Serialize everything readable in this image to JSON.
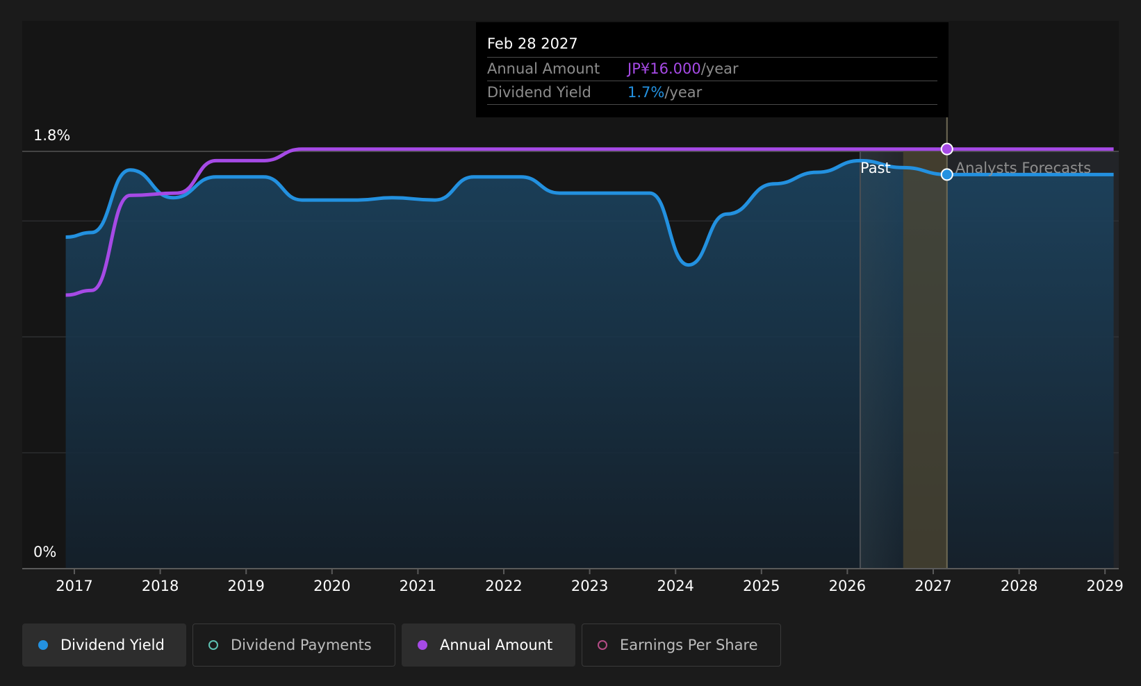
{
  "chart_data": {
    "type": "line",
    "y_axis_labels": [
      "1.8%",
      "0%"
    ],
    "ylim": [
      0,
      1.8
    ],
    "x_tick_labels": [
      "2017",
      "2018",
      "2019",
      "2020",
      "2021",
      "2022",
      "2023",
      "2024",
      "2025",
      "2026",
      "2027",
      "2028",
      "2029"
    ],
    "xlim": [
      2016.4,
      2029.1
    ],
    "grid": true,
    "region_labels": {
      "past": "Past",
      "forecast": "Analysts Forecasts"
    },
    "past_boundary_x": 2026.15,
    "forecast_highlight": [
      2026.65,
      2027.16
    ],
    "series": [
      {
        "name": "Dividend Yield",
        "color": "#2391e0",
        "points": [
          [
            2016.9,
            1.43
          ],
          [
            2017.2,
            1.45
          ],
          [
            2017.65,
            1.72
          ],
          [
            2018.15,
            1.6
          ],
          [
            2018.65,
            1.69
          ],
          [
            2019.2,
            1.69
          ],
          [
            2019.65,
            1.59
          ],
          [
            2020.3,
            1.59
          ],
          [
            2020.7,
            1.6
          ],
          [
            2021.2,
            1.59
          ],
          [
            2021.65,
            1.69
          ],
          [
            2022.2,
            1.69
          ],
          [
            2022.65,
            1.62
          ],
          [
            2023.7,
            1.62
          ],
          [
            2024.15,
            1.31
          ],
          [
            2024.6,
            1.53
          ],
          [
            2025.15,
            1.66
          ],
          [
            2025.65,
            1.71
          ],
          [
            2026.15,
            1.76
          ],
          [
            2026.65,
            1.73
          ],
          [
            2027.16,
            1.7
          ],
          [
            2029.1,
            1.7
          ]
        ]
      },
      {
        "name": "Annual Amount",
        "color": "#a64ae6",
        "points": [
          [
            2016.9,
            1.18
          ],
          [
            2017.2,
            1.2
          ],
          [
            2017.65,
            1.61
          ],
          [
            2018.2,
            1.62
          ],
          [
            2018.65,
            1.76
          ],
          [
            2019.2,
            1.76
          ],
          [
            2019.65,
            1.81
          ],
          [
            2029.1,
            1.81
          ]
        ]
      }
    ],
    "tooltip": {
      "date": "Feb 28 2027",
      "x": 2027.16,
      "rows": [
        {
          "label": "Annual Amount",
          "value": "JP¥16.000",
          "unit": "/year",
          "color": "purple"
        },
        {
          "label": "Dividend Yield",
          "value": "1.7%",
          "unit": "/year",
          "color": "blue"
        }
      ]
    }
  },
  "legend": [
    {
      "label": "Dividend Yield",
      "active": true,
      "color": "#2391e0",
      "filled": true
    },
    {
      "label": "Dividend Payments",
      "active": false,
      "color": "#5ec2b3",
      "filled": false
    },
    {
      "label": "Annual Amount",
      "active": true,
      "color": "#a64ae6",
      "filled": true
    },
    {
      "label": "Earnings Per Share",
      "active": false,
      "color": "#b54d86",
      "filled": false
    }
  ]
}
